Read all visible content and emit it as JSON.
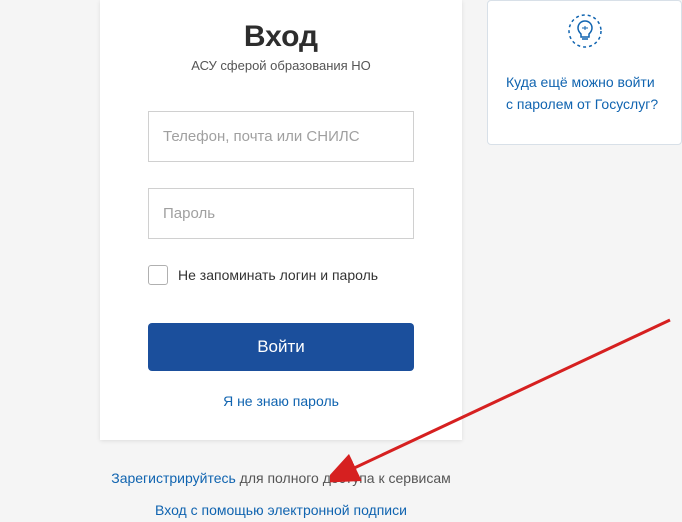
{
  "login": {
    "title": "Вход",
    "subtitle": "АСУ сферой образования НО",
    "login_placeholder": "Телефон, почта или СНИЛС",
    "password_placeholder": "Пароль",
    "remember_label": "Не запоминать логин и пароль",
    "submit_label": "Войти",
    "forgot_label": "Я не знаю пароль"
  },
  "side": {
    "link_text": "Куда ещё можно войти с паролем от Госуслуг?"
  },
  "footer": {
    "register_link": "Зарегистрируйтесь",
    "register_text": " для полного доступа к сервисам",
    "esign_link": "Вход с помощью электронной подписи"
  }
}
